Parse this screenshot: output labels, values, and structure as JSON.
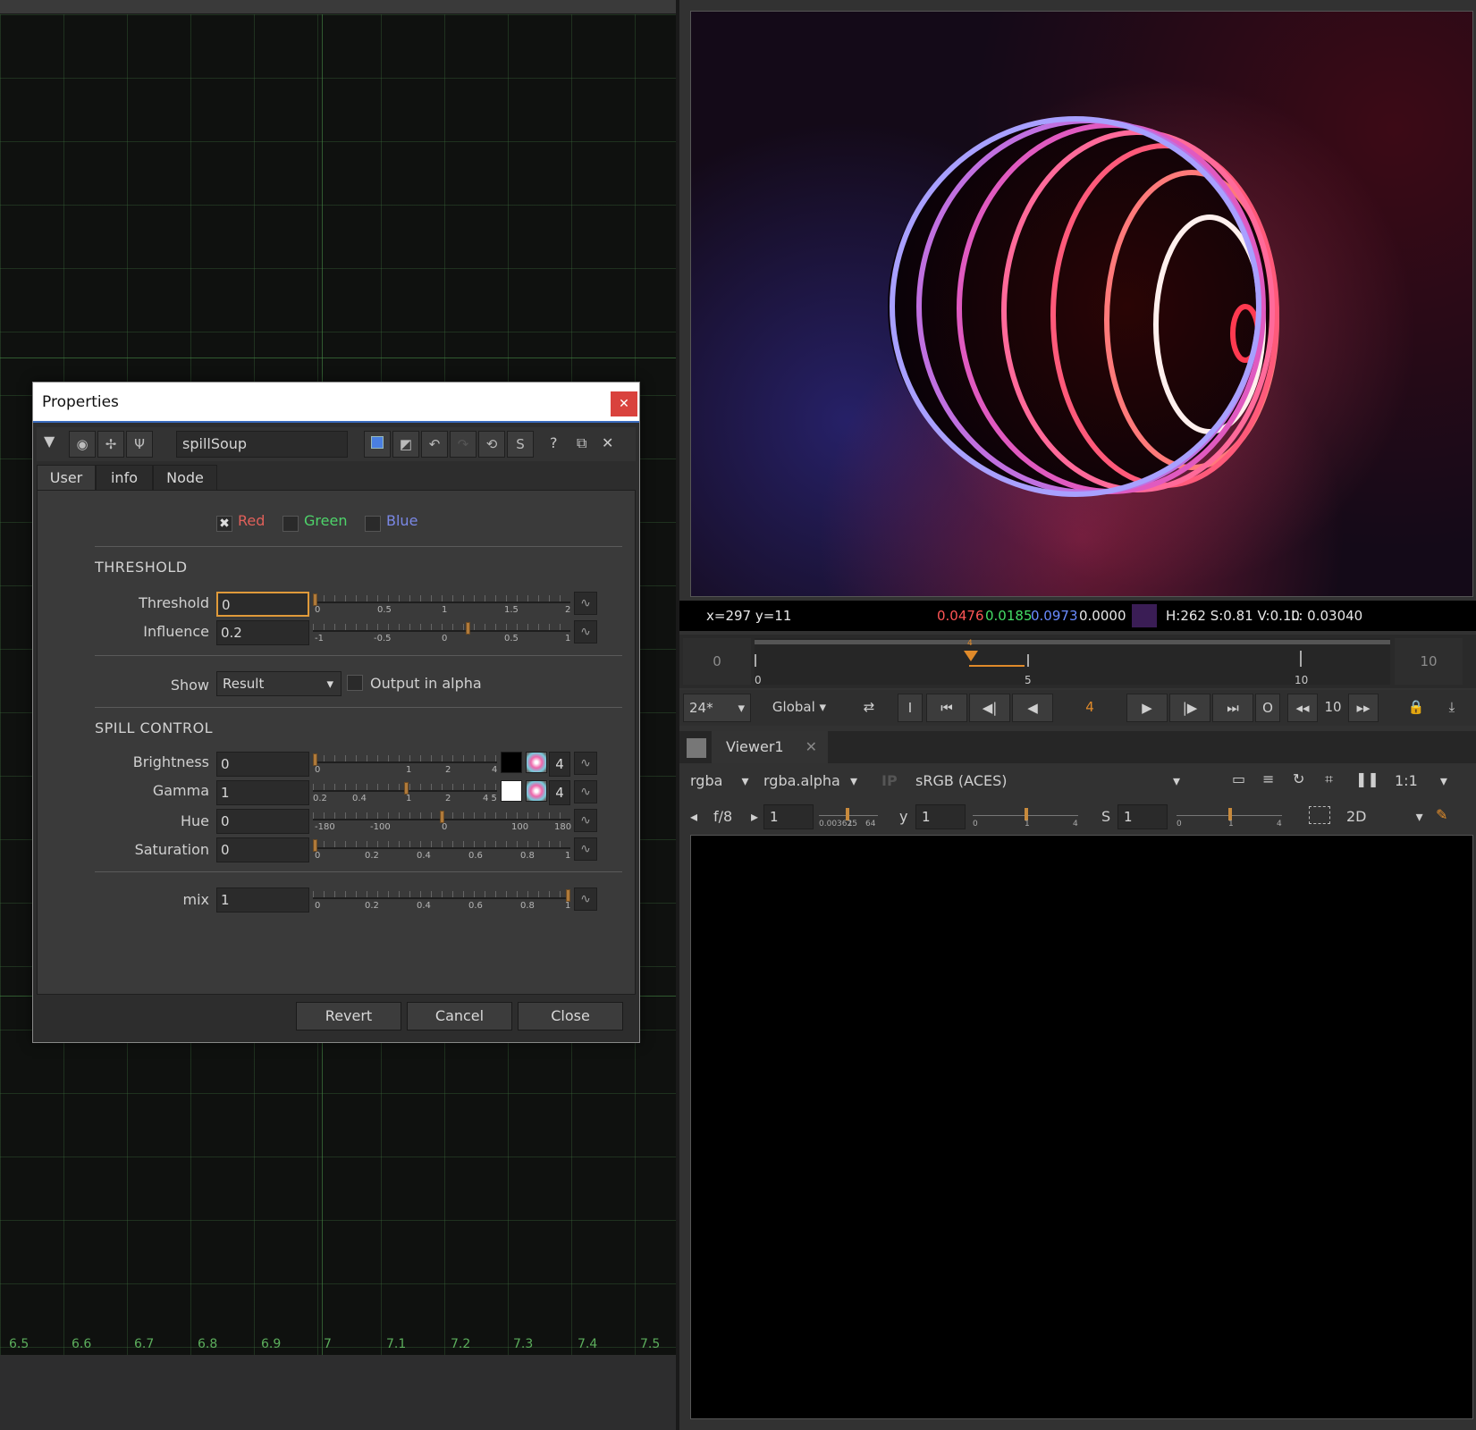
{
  "graph": {
    "axis_labels": [
      "6.5",
      "6.6",
      "6.7",
      "6.8",
      "6.9",
      "7",
      "7.1",
      "7.2",
      "7.3",
      "7.4",
      "7.5"
    ]
  },
  "viewer": {
    "info": {
      "coords": "x=297 y=11",
      "r": "0.0476",
      "g": "0.0185",
      "b": "0.0973",
      "a": "0.0000",
      "hsv": "H:262 S:0.81 V:0.10",
      "lum": "L: 0.03040",
      "r_color": "#ff5555",
      "g_color": "#44dd66",
      "b_color": "#6a8cff",
      "swatch_color": "#3a1d55"
    },
    "timeline": {
      "start": "0",
      "end": "10",
      "ticks": [
        "0",
        "5",
        "10"
      ],
      "current_marker": "4"
    },
    "transport": {
      "fps": "24*",
      "mode": "Global",
      "frame": "4",
      "step": "10",
      "in_label": "I",
      "out_label": "O"
    },
    "tab": {
      "label": "Viewer1"
    },
    "controls": {
      "channels": "rgba",
      "alpha": "rgba.alpha",
      "ip": "IP",
      "colorspace": "sRGB (ACES)",
      "zoom": "1:1",
      "fstop_label": "f/8",
      "gain_value": "1",
      "gain_ticks": [
        "0.003625",
        "1",
        "64"
      ],
      "gamma_label": "y",
      "gamma_value": "1",
      "gamma_ticks": [
        "0",
        "1",
        "4"
      ],
      "sat_label": "S",
      "sat_value": "1",
      "sat_ticks": [
        "0",
        "1",
        "4"
      ],
      "view_mode": "2D"
    }
  },
  "props": {
    "title": "Properties",
    "node_name": "spillSoup",
    "tabs": [
      "User",
      "info",
      "Node"
    ],
    "channels": {
      "red": "Red",
      "green": "Green",
      "blue": "Blue",
      "red_color": "#e0605a",
      "green_color": "#4ed36a",
      "blue_color": "#7a88e6"
    },
    "threshold_section": "THRESHOLD",
    "threshold": {
      "label": "Threshold",
      "value": "0",
      "ticks": [
        "0",
        "0.5",
        "1",
        "1.5",
        "2"
      ]
    },
    "influence": {
      "label": "Influence",
      "value": "0.2",
      "ticks": [
        "-1",
        "-0.5",
        "0",
        "0.5",
        "1"
      ]
    },
    "show": {
      "label": "Show",
      "value": "Result",
      "output_alpha": "Output in alpha"
    },
    "spill_section": "SPILL CONTROL",
    "brightness": {
      "label": "Brightness",
      "value": "0",
      "ticks": [
        "0",
        "1",
        "2",
        "4"
      ],
      "count": "4"
    },
    "gamma": {
      "label": "Gamma",
      "value": "1",
      "ticks": [
        "0.2",
        "0.4",
        "1",
        "2",
        "4 5"
      ],
      "count": "4"
    },
    "hue": {
      "label": "Hue",
      "value": "0",
      "ticks": [
        "-180",
        "-100",
        "0",
        "100",
        "180"
      ]
    },
    "saturation": {
      "label": "Saturation",
      "value": "0",
      "ticks": [
        "0",
        "0.2",
        "0.4",
        "0.6",
        "0.8",
        "1"
      ]
    },
    "mix": {
      "label": "mix",
      "value": "1",
      "ticks": [
        "0",
        "0.2",
        "0.4",
        "0.6",
        "0.8",
        "1"
      ]
    },
    "buttons": {
      "revert": "Revert",
      "cancel": "Cancel",
      "close": "Close"
    }
  }
}
